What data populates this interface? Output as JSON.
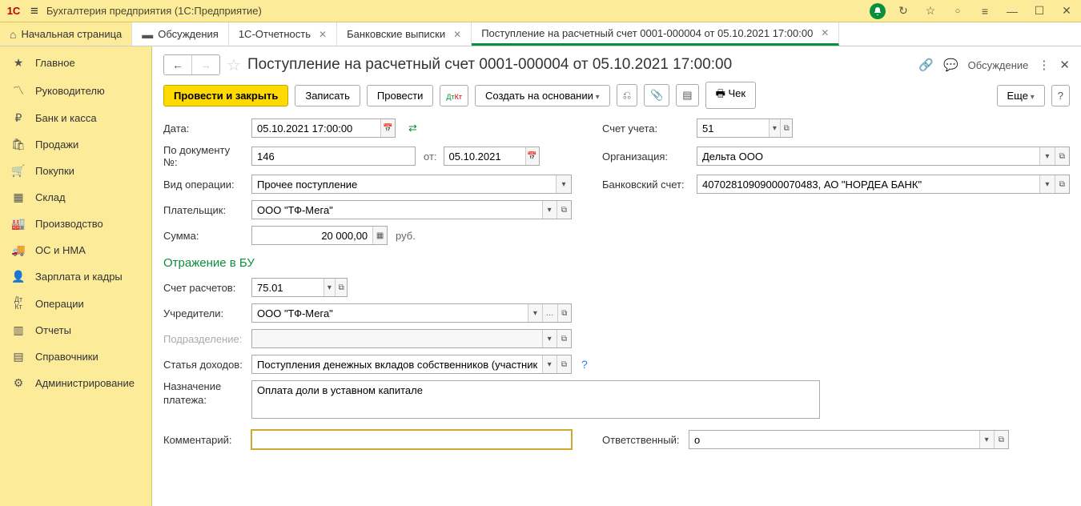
{
  "titlebar": {
    "app_title": "Бухгалтерия предприятия  (1С:Предприятие)"
  },
  "tabs": [
    {
      "label": "Начальная страница",
      "closable": false,
      "home": true
    },
    {
      "label": "Обсуждения",
      "closable": false
    },
    {
      "label": "1С-Отчетность",
      "closable": true
    },
    {
      "label": "Банковские выписки",
      "closable": true
    },
    {
      "label": "Поступление на расчетный счет 0001-000004 от 05.10.2021 17:00:00",
      "closable": true,
      "active": true
    }
  ],
  "sidebar": [
    {
      "icon": "star",
      "label": "Главное"
    },
    {
      "icon": "chart",
      "label": "Руководителю"
    },
    {
      "icon": "ruble",
      "label": "Банк и касса"
    },
    {
      "icon": "bag",
      "label": "Продажи"
    },
    {
      "icon": "cart",
      "label": "Покупки"
    },
    {
      "icon": "box",
      "label": "Склад"
    },
    {
      "icon": "factory",
      "label": "Производство"
    },
    {
      "icon": "truck",
      "label": "ОС и НМА"
    },
    {
      "icon": "person",
      "label": "Зарплата и кадры"
    },
    {
      "icon": "dtkt",
      "label": "Операции"
    },
    {
      "icon": "bars",
      "label": "Отчеты"
    },
    {
      "icon": "book",
      "label": "Справочники"
    },
    {
      "icon": "gear",
      "label": "Администрирование"
    }
  ],
  "doc": {
    "title": "Поступление на расчетный счет 0001-000004 от 05.10.2021 17:00:00",
    "discuss_label": "Обсуждение"
  },
  "toolbar": {
    "post_close": "Провести и закрыть",
    "save": "Записать",
    "post": "Провести",
    "create_based": "Создать на основании",
    "cheque": "Чек",
    "more": "Еще"
  },
  "labels": {
    "date": "Дата:",
    "doc_num": "По документу №:",
    "from": "от:",
    "op_type": "Вид операции:",
    "payer": "Плательщик:",
    "sum": "Сумма:",
    "rub": "руб.",
    "account": "Счет учета:",
    "org": "Организация:",
    "bank_acc": "Банковский счет:",
    "section_bu": "Отражение в БУ",
    "calc_acc": "Счет расчетов:",
    "founders": "Учредители:",
    "division": "Подразделение:",
    "income_item": "Статья доходов:",
    "purpose": "Назначение платежа:",
    "comment": "Комментарий:",
    "responsible": "Ответственный:"
  },
  "values": {
    "date": "05.10.2021 17:00:00",
    "doc_num": "146",
    "doc_date": "05.10.2021",
    "op_type": "Прочее поступление",
    "payer": "ООО \"ТФ-Мега\"",
    "sum": "20 000,00",
    "account": "51",
    "org": "Дельта ООО",
    "bank_acc": "40702810909000070483, АО \"НОРДЕА БАНК\"",
    "calc_acc": "75.01",
    "founders": "ООО \"ТФ-Мега\"",
    "division": "",
    "income_item": "Поступления денежных вкладов собственников (участников",
    "purpose": "Оплата доли в уставном капитале",
    "comment": "",
    "responsible": "о"
  }
}
